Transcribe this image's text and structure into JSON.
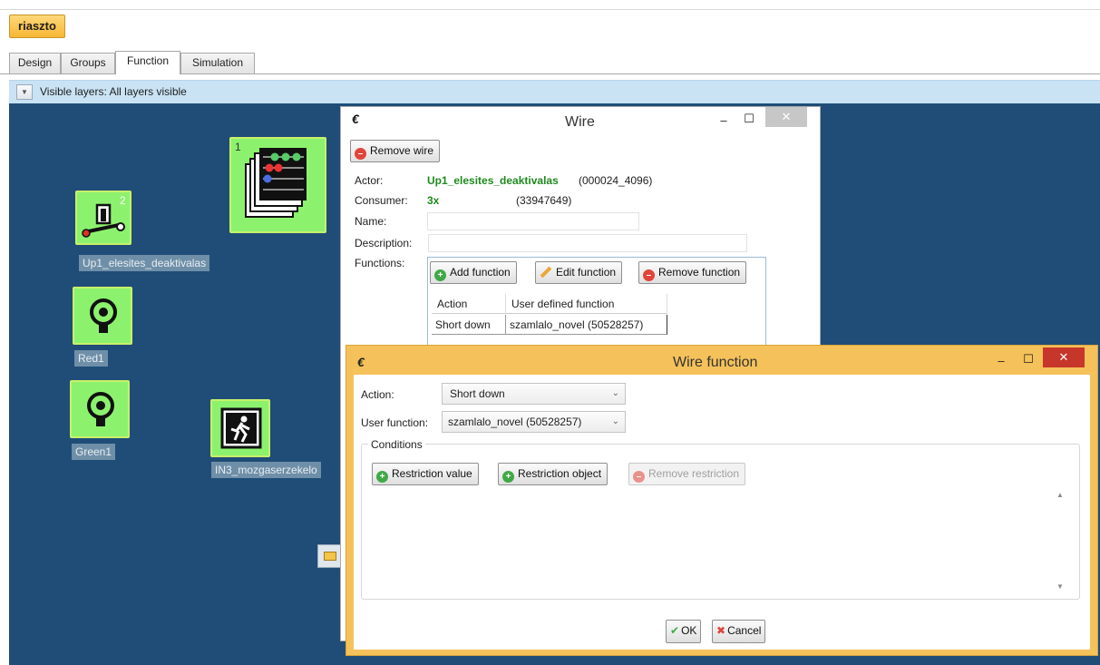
{
  "project": {
    "name": "riaszto"
  },
  "tabs": [
    {
      "label": "Design"
    },
    {
      "label": "Groups"
    },
    {
      "label": "Function"
    },
    {
      "label": "Simulation"
    }
  ],
  "active_tab": "Function",
  "layers": {
    "label": "Visible layers: All layers visible"
  },
  "canvas": {
    "nodes": [
      {
        "label": "Up1_elesites_deaktivalas",
        "badge": "2",
        "icon": "push-button-icon"
      },
      {
        "label": "",
        "badge": "1",
        "icon": "counter-stack-icon"
      },
      {
        "label": "Red1",
        "icon": "lamp-icon"
      },
      {
        "label": "Green1",
        "icon": "lamp-icon"
      },
      {
        "label": "IN3_mozgaserzekelo",
        "icon": "motion-sensor-icon"
      }
    ]
  },
  "wire_window": {
    "title": "Wire",
    "remove_wire": "Remove wire",
    "actor_label": "Actor:",
    "actor_name": "Up1_elesites_deaktivalas",
    "actor_id": "(000024_4096)",
    "consumer_label": "Consumer:",
    "consumer_name": "3x",
    "consumer_id": "(33947649)",
    "name_label": "Name:",
    "name_value": "",
    "description_label": "Description:",
    "description_value": "",
    "functions_label": "Functions:",
    "add_function": "Add function",
    "edit_function": "Edit function",
    "remove_function": "Remove function",
    "grid": {
      "columns": [
        "Action",
        "User defined function"
      ],
      "rows": [
        [
          "Short down",
          "szamlalo_novel (50528257)"
        ]
      ]
    }
  },
  "wire_function_window": {
    "title": "Wire function",
    "action_label": "Action:",
    "action_value": "Short down",
    "user_function_label": "User function:",
    "user_function_value": "szamlalo_novel (50528257)",
    "conditions_label": "Conditions",
    "restriction_value": "Restriction value",
    "restriction_object": "Restriction object",
    "remove_restriction": "Remove restriction",
    "ok": "OK",
    "cancel": "Cancel"
  },
  "colors": {
    "canvas": "#1f4d78",
    "node_fill": "#8cf26e",
    "accent_orange": "#f5c15a",
    "close_red": "#c7362a"
  }
}
